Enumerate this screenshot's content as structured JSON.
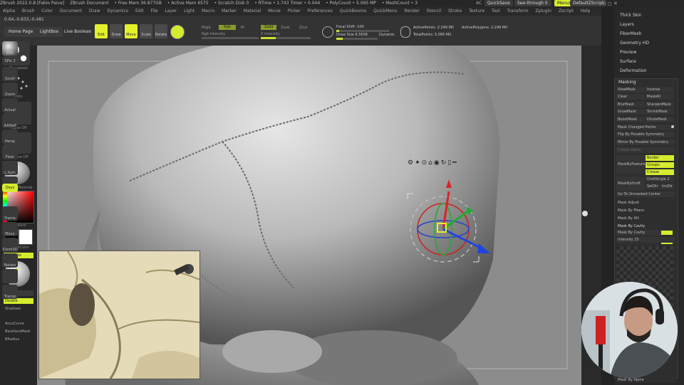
{
  "titlebar": {
    "app": "ZBrush 2022.0.8 [Fabio Paiva]",
    "doc": "ZBrush Document",
    "stats": [
      "• Free Mem 36.877GB",
      "• Active Mem 6575",
      "• Scratch Disk 0",
      "• RTime • 1.743 Timer • 0.044",
      "• PolyCount • 5.095 MP",
      "• MeshCount • 3"
    ],
    "ac": "AC",
    "quicksave": "QuickSave",
    "seethrough": "See-through",
    "seethrough_val": "0",
    "menus": "Menus",
    "script": "DefaultZScript"
  },
  "menubar": [
    "Alpha",
    "Brush",
    "Color",
    "Document",
    "Draw",
    "Dynamics",
    "Edit",
    "File",
    "Layer",
    "Light",
    "Macro",
    "Marker",
    "Material",
    "Movie",
    "Picker",
    "Preferences",
    "QuickBooms",
    "QuickMenu",
    "Render",
    "Stencil",
    "Stroke",
    "Texture",
    "Tool",
    "Transform",
    "Zplugin",
    "Zscript",
    "Help"
  ],
  "toolbar": {
    "coords": "0.64,-0.833,-0.481",
    "home": "Home Page",
    "lightbox": "LightBox",
    "liveboolean": "Live Boolean",
    "edit": "Edit",
    "draw": "Draw",
    "move": "Move",
    "scale": "Scale",
    "rotate": "Rotate",
    "mrgb": "Mrgb",
    "rgb": "Rgb",
    "m": "M",
    "zadd": "Zadd",
    "zsub": "Zsub",
    "zcut": "Zcut",
    "rgb_intensity": "Rgb Intensity",
    "z_intensity": "Z Intensity",
    "focal_shift": "Focal Shift -100",
    "draw_size": "Draw Size 6.5636",
    "dynamic": "Dynamic",
    "active_points": "ActivePoints: 2.249 Mil",
    "active_polys": "ActivePolygons: 2.249 Mil",
    "total_points": "TotalPoints: 5.095 Mil",
    "focal_pct": 0.05,
    "drawsize_pct": 0.15
  },
  "leftshelf": {
    "transpose": "Transpose",
    "dots": "Dots",
    "alpha_off": "Alpha Off",
    "texture_off": "Texture Off",
    "material": "StartupMaterial",
    "gradient": "Gradient",
    "switchcolor": "SwitchColor",
    "alternate": "Alternate",
    "flip": "Flip",
    "double": "Double",
    "shadows": "Shadows",
    "accucurve": "AccuCurve",
    "backfacemask": "BackfaceMask",
    "bradius": "BRadius"
  },
  "rightshelf": [
    "BPR",
    "SPix 3",
    "Scroll",
    "Zoom",
    "Actual",
    "AAHalf",
    "Persp",
    "Floor",
    "L.Sym",
    "",
    "Qxyz",
    "",
    "Frame",
    "Move",
    "Zoom3D",
    "Rotate",
    "",
    "Transp"
  ],
  "rpanel": {
    "thick_skin": "Thick Skin",
    "layers": "Layers",
    "fibermesh": "FiberMesh",
    "geometry_hd": "Geometry HD",
    "preview": "Preview",
    "surface": "Surface",
    "deformation": "Deformation",
    "masking": "Masking",
    "viewmask": "ViewMask",
    "inverse": "Inverse",
    "clear": "Clear",
    "maskall": "MaskAll",
    "blurmask": "BlurMask",
    "sharpenmask": "SharpenMask",
    "growmask": "GrowMask",
    "shrinkmask": "ShrinkMask",
    "boostmask": "BoostMask",
    "dilutemask": "DiluteMask",
    "mask_changed": "Mask Changed Points",
    "flip_posable": "Flip By Posable Symmetry",
    "mirror_posable": "Mirror By Posable Symmetry",
    "create_alpha": "Create Alpha",
    "mask_by_feature": "MaskByFeature",
    "border": "Border",
    "groups": "Groups",
    "crease": "Crease",
    "mask_by_draft": "MaskByDraft",
    "draft_angle": "DraftAngle 2",
    "setdir": "SetDir",
    "invdir": "InvDir",
    "go_unmasked": "Go To Unmasked Center",
    "mask_adjust": "Mask Adjust",
    "mask_by_fibers": "Mask By Fibers",
    "mask_by_ao": "Mask By AO",
    "mask_by_cavity": "Mask By Cavity",
    "mask_by_cavity2": "Mask By Cavity",
    "intensity": "Intensity 25",
    "mask_by_alpha": "Mask By Alpha"
  },
  "colors": {
    "accent": "#d6eb2e",
    "bg": "#272727",
    "viewport": "#8c8c8c"
  }
}
